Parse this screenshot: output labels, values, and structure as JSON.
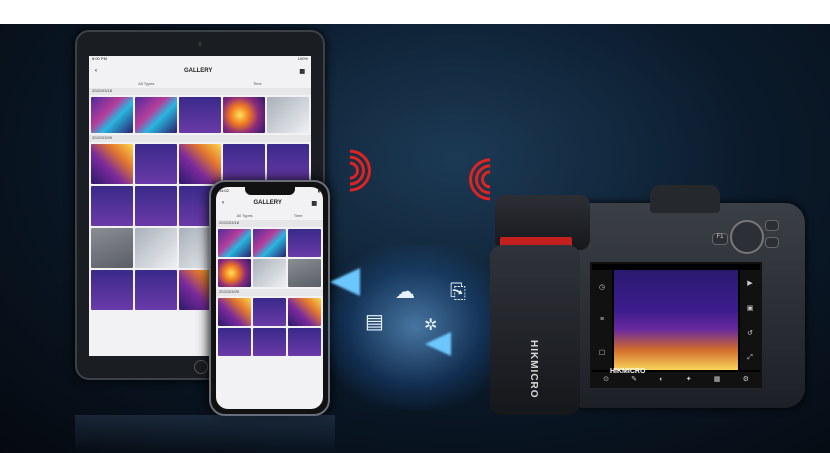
{
  "caption": "",
  "tablet": {
    "title": "GALLERY",
    "status_left": "8:00 PM",
    "status_right": "100%",
    "filter_left": "All Types",
    "filter_right": "Time",
    "date1": "2022/03/18",
    "date2": "2022/03/09"
  },
  "phone": {
    "time": "14:02",
    "title": "GALLERY",
    "filter_left": "All Types",
    "filter_right": "Time",
    "date1": "2022/03/18",
    "date2": "2022/03/09"
  },
  "transfer": {
    "icons": [
      "cloud-upload-icon",
      "camera-icon",
      "document-icon",
      "gear-icon"
    ]
  },
  "camera": {
    "brand": "HIKMICRO",
    "lcd_logo": "HIKMICRO",
    "btn_f1": "F1",
    "colors": {
      "accent": "#e0231f",
      "beam": "#6cc7ff"
    }
  }
}
